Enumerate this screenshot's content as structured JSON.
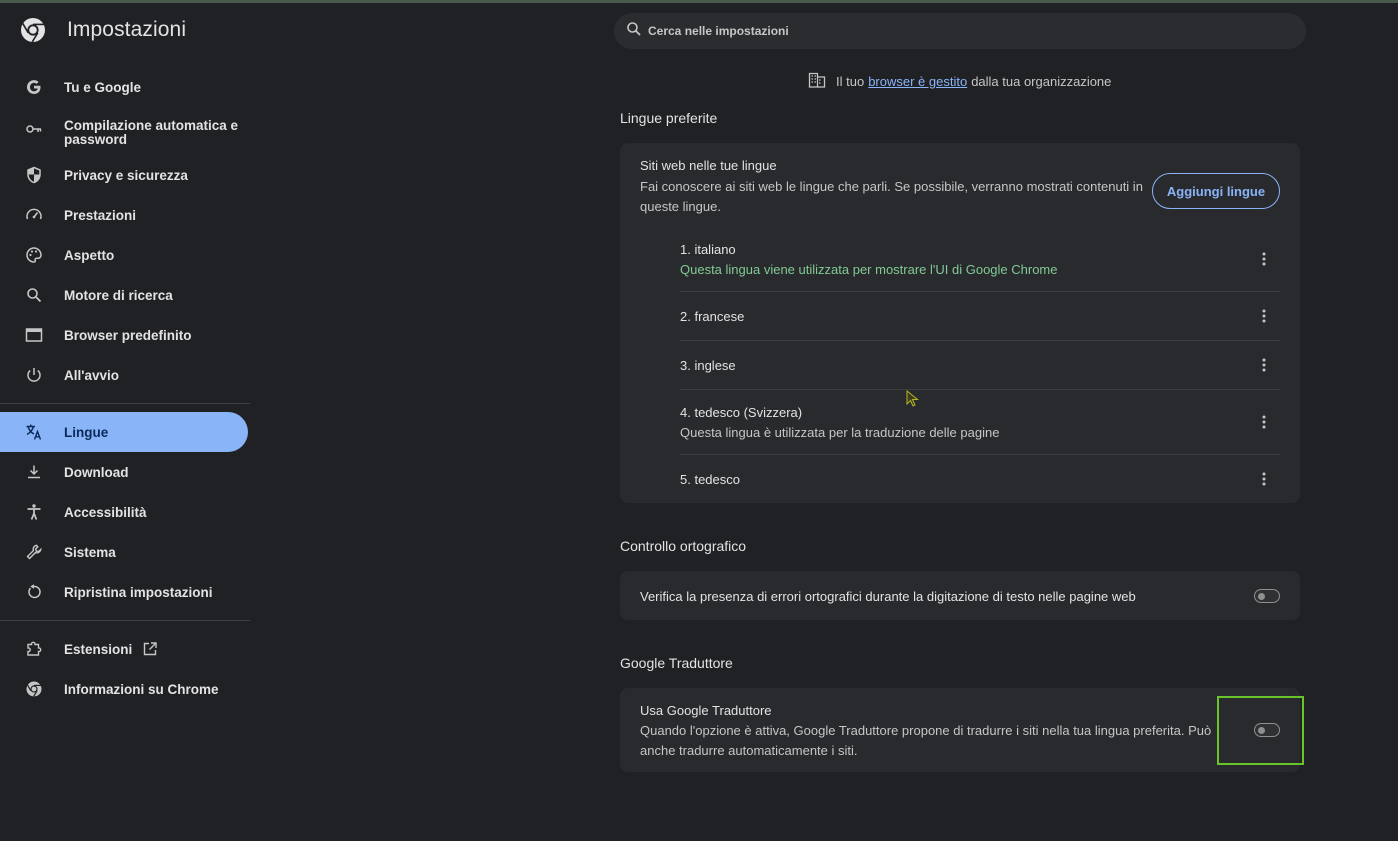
{
  "sidebar": {
    "title": "Impostazioni",
    "items": [
      {
        "label": "Tu e Google",
        "icon": "google-g-icon"
      },
      {
        "label": "Compilazione automatica e password",
        "icon": "key-icon"
      },
      {
        "label": "Privacy e sicurezza",
        "icon": "shield-icon"
      },
      {
        "label": "Prestazioni",
        "icon": "speedometer-icon"
      },
      {
        "label": "Aspetto",
        "icon": "palette-icon"
      },
      {
        "label": "Motore di ricerca",
        "icon": "search-icon"
      },
      {
        "label": "Browser predefinito",
        "icon": "browser-window-icon"
      },
      {
        "label": "All'avvio",
        "icon": "power-icon"
      },
      {
        "label": "Lingue",
        "icon": "translate-icon",
        "active": true
      },
      {
        "label": "Download",
        "icon": "download-icon"
      },
      {
        "label": "Accessibilità",
        "icon": "accessibility-icon"
      },
      {
        "label": "Sistema",
        "icon": "wrench-icon"
      },
      {
        "label": "Ripristina impostazioni",
        "icon": "reset-icon"
      },
      {
        "label": "Estensioni",
        "icon": "puzzle-icon"
      },
      {
        "label": "Informazioni su Chrome",
        "icon": "chrome-icon"
      }
    ]
  },
  "search": {
    "placeholder": "Cerca nelle impostazioni"
  },
  "managed": {
    "prefix": "Il tuo",
    "link": "browser è gestito",
    "suffix": "dalla tua organizzazione"
  },
  "languages": {
    "section_title": "Lingue preferite",
    "card_title": "Siti web nelle tue lingue",
    "card_desc": "Fai conoscere ai siti web le lingue che parli. Se possibile, verranno mostrati contenuti in queste lingue.",
    "add_button": "Aggiungi lingue",
    "list": [
      {
        "name": "1. italiano",
        "note": "Questa lingua viene utilizzata per mostrare l'UI di Google Chrome"
      },
      {
        "name": "2. francese",
        "note": ""
      },
      {
        "name": "3. inglese",
        "note": ""
      },
      {
        "name": "4. tedesco (Svizzera)",
        "note": "Questa lingua è utilizzata per la traduzione delle pagine"
      },
      {
        "name": "5. tedesco",
        "note": ""
      }
    ]
  },
  "spellcheck": {
    "section_title": "Controllo ortografico",
    "text": "Verifica la presenza di errori ortografici durante la digitazione di testo nelle pagine web",
    "enabled": false
  },
  "translate": {
    "section_title": "Google Traduttore",
    "title": "Usa Google Traduttore",
    "desc": "Quando l'opzione è attiva, Google Traduttore propone di tradurre i siti nella tua lingua preferita. Può anche tradurre automaticamente i siti.",
    "enabled": false
  },
  "colors": {
    "accent": "#8ab4f8",
    "background": "#202124",
    "card": "#292a2d",
    "note_green": "#81c995",
    "highlight": "#67c52a"
  }
}
